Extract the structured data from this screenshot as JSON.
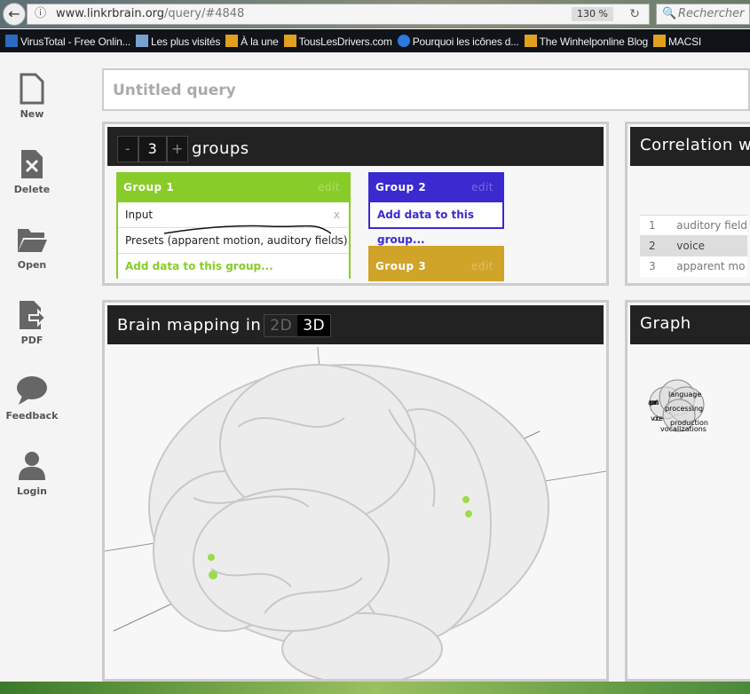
{
  "browser": {
    "url_domain": "www.linkrbrain.org",
    "url_path": "/query/#4848",
    "zoom": "130 %",
    "search_placeholder": "Rechercher",
    "bookmarks": [
      "VirusTotal - Free Onlin...",
      "Les plus visités",
      "À la une",
      "TousLesDrivers.com",
      "Pourquoi les icônes d...",
      "The Winhelponline Blog",
      "MACSI"
    ]
  },
  "sidebar": [
    {
      "label": "New",
      "icon": "file-icon"
    },
    {
      "label": "Delete",
      "icon": "delete-file-icon"
    },
    {
      "label": "Open",
      "icon": "folder-icon"
    },
    {
      "label": "PDF",
      "icon": "export-pdf-icon"
    },
    {
      "label": "Feedback",
      "icon": "speech-bubble-icon"
    },
    {
      "label": "Login",
      "icon": "user-icon"
    }
  ],
  "query": {
    "title": "Untitled query"
  },
  "groups": {
    "minus": "-",
    "count": "3",
    "plus": "+",
    "label": "groups",
    "list": [
      {
        "name": "Group 1",
        "edit": "edit",
        "color": "#88cc2a",
        "items": [
          "Input",
          "Presets (apparent motion, auditory fields)"
        ],
        "remove": "x",
        "add": "Add data to this group..."
      },
      {
        "name": "Group 2",
        "edit": "edit",
        "color": "#3a2ad0",
        "items": [],
        "add": "Add data to this group..."
      },
      {
        "name": "Group 3",
        "edit": "edit",
        "color": "#d0a428"
      }
    ]
  },
  "correlation": {
    "title": "Correlation w",
    "rows": [
      {
        "rank": "1",
        "term": "auditory field"
      },
      {
        "rank": "2",
        "term": "voice"
      },
      {
        "rank": "3",
        "term": "apparent mo"
      }
    ]
  },
  "brain": {
    "title": "Brain mapping in",
    "mode_2d": "2D",
    "mode_3d": "3D",
    "active": "3D"
  },
  "graph": {
    "title": "Graph",
    "nodes": [
      "language",
      "processing",
      "production",
      "vocalizations",
      "apparent",
      "voice"
    ]
  }
}
